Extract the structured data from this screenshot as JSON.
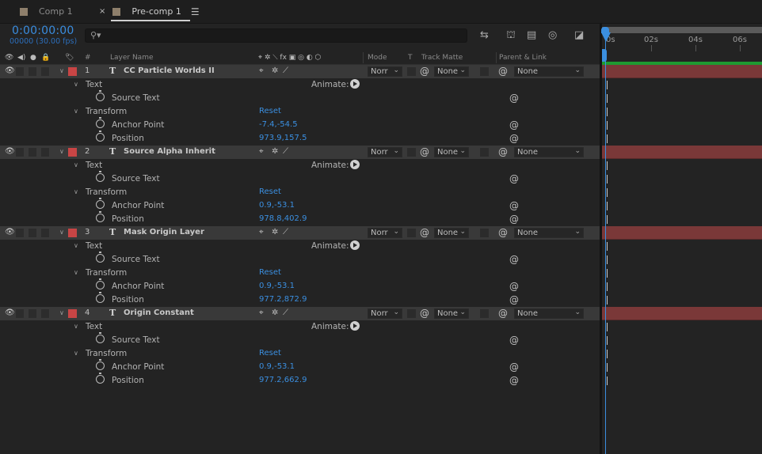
{
  "tabs": [
    {
      "label": "Comp 1",
      "swatch": "#8e7f6b"
    },
    {
      "label": "Pre-comp 1",
      "swatch": "#8e7f6b",
      "close": "×",
      "menu": "☰"
    }
  ],
  "timecode": "0:00:00:00",
  "frames": "00000 (30.00 fps)",
  "search": {
    "placeholder": "",
    "icon": "search-icon"
  },
  "columns": {
    "num": "#",
    "layer_name": "Layer Name",
    "mode": "Mode",
    "t": "T",
    "track_matte": "Track Matte",
    "parent_link": "Parent & Link"
  },
  "ruler": {
    "labels": [
      "0s",
      "02s",
      "04s",
      "06s"
    ]
  },
  "animate_label": "Animate:",
  "reset_label": "Reset",
  "layers": [
    {
      "num": "1",
      "name": "CC Particle Worlds II",
      "mode": "Norr",
      "matte": "None",
      "parent": "None",
      "text_group": "Text",
      "source_text": "Source Text",
      "transform": "Transform",
      "anchor_label": "Anchor Point",
      "anchor": "-7.4,-54.5",
      "position_label": "Position",
      "position": "973.9,157.5"
    },
    {
      "num": "2",
      "name": "Source Alpha Inherit",
      "mode": "Norr",
      "matte": "None",
      "parent": "None",
      "text_group": "Text",
      "source_text": "Source Text",
      "transform": "Transform",
      "anchor_label": "Anchor Point",
      "anchor": "0.9,-53.1",
      "position_label": "Position",
      "position": "978.8,402.9"
    },
    {
      "num": "3",
      "name": "Mask Origin Layer",
      "mode": "Norr",
      "matte": "None",
      "parent": "None",
      "text_group": "Text",
      "source_text": "Source Text",
      "transform": "Transform",
      "anchor_label": "Anchor Point",
      "anchor": "0.9,-53.1",
      "position_label": "Position",
      "position": "977.2,872.9"
    },
    {
      "num": "4",
      "name": "Origin Constant",
      "mode": "Norr",
      "matte": "None",
      "parent": "None",
      "text_group": "Text",
      "source_text": "Source Text",
      "transform": "Transform",
      "anchor_label": "Anchor Point",
      "anchor": "0.9,-53.1",
      "position_label": "Position",
      "position": "977.2,662.9"
    }
  ],
  "colors": {
    "accent": "#3b8fe0",
    "label_red": "#c84545",
    "layer_bar": "#7a3838",
    "work_area": "#1e9a31"
  }
}
